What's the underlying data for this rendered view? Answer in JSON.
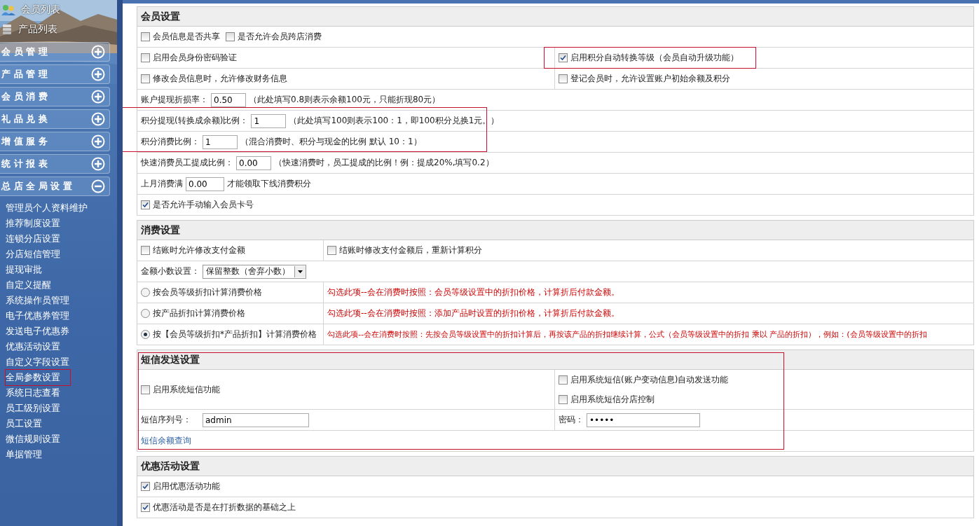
{
  "sidebar": {
    "top_links": [
      {
        "label": "会员列表"
      },
      {
        "label": "产品列表"
      }
    ],
    "groups": [
      {
        "label": "会 员 管 理",
        "expanded": false
      },
      {
        "label": "产 品 管 理",
        "expanded": false
      },
      {
        "label": "会 员 消 费",
        "expanded": false
      },
      {
        "label": "礼 品 兑 换",
        "expanded": false
      },
      {
        "label": "增 值 服 务",
        "expanded": false
      },
      {
        "label": "统 计 报 表",
        "expanded": false
      },
      {
        "label": "总 店 全 局 设 置",
        "expanded": true,
        "items": [
          {
            "label": "管理员个人资料维护",
            "highlighted": false
          },
          {
            "label": "推荐制度设置",
            "highlighted": false
          },
          {
            "label": "连锁分店设置",
            "highlighted": false
          },
          {
            "label": "分店短信管理",
            "highlighted": false
          },
          {
            "label": "提现审批",
            "highlighted": false
          },
          {
            "label": "自定义提醒",
            "highlighted": false
          },
          {
            "label": "系统操作员管理",
            "highlighted": false
          },
          {
            "label": "电子优惠券管理",
            "highlighted": false
          },
          {
            "label": "发送电子优惠券",
            "highlighted": false
          },
          {
            "label": "优惠活动设置",
            "highlighted": false
          },
          {
            "label": "自定义字段设置",
            "highlighted": false
          },
          {
            "label": "全局参数设置",
            "highlighted": true
          },
          {
            "label": "系统日志查看",
            "highlighted": false
          },
          {
            "label": "员工级别设置",
            "highlighted": false
          },
          {
            "label": "员工设置",
            "highlighted": false
          },
          {
            "label": "微信规则设置",
            "highlighted": false
          },
          {
            "label": "单据管理",
            "highlighted": false
          }
        ]
      }
    ]
  },
  "sections": [
    {
      "title": "会员设置",
      "highlighted": false,
      "rows": [
        {
          "kind": "checks",
          "cells": [
            [
              {
                "label": "会员信息是否共享",
                "checked": false,
                "highlighted": false
              },
              {
                "label": "是否允许会员跨店消费",
                "checked": false,
                "highlighted": false
              }
            ]
          ]
        },
        {
          "kind": "checks",
          "cells": [
            [
              {
                "label": "启用会员身份密码验证",
                "checked": false,
                "highlighted": false
              }
            ],
            [
              {
                "label": "启用积分自动转换等级（会员自动升级功能）",
                "checked": true,
                "highlighted": true
              }
            ]
          ]
        },
        {
          "kind": "checks",
          "cells": [
            [
              {
                "label": "修改会员信息时，允许修改财务信息",
                "checked": false,
                "highlighted": false
              }
            ],
            [
              {
                "label": "登记会员时，允许设置账户初始余额及积分",
                "checked": false,
                "highlighted": false
              }
            ]
          ]
        },
        {
          "kind": "field",
          "label": "账户提现折损率：",
          "value": "0.50",
          "note": "（此处填写0.8则表示余额100元，只能折现80元）"
        },
        {
          "kind": "group",
          "highlighted": true,
          "rows": [
            {
              "kind": "field",
              "label": "积分提现(转换成余额)比例：",
              "value": "1",
              "note": "（此处填写100则表示100：1，即100积分兑换1元。）"
            },
            {
              "kind": "field",
              "label": "积分消费比例：",
              "value": "1",
              "note": "（混合消费时、积分与现金的比例 默认 10：1）"
            }
          ]
        },
        {
          "kind": "field",
          "label": "快速消费员工提成比例：",
          "value": "0.00",
          "note": "（快速消费时，员工提成的比例！例：提成20%,填写0.2）"
        },
        {
          "kind": "field",
          "label": "上月消费满",
          "value": "0.00",
          "note": "才能领取下线消费积分"
        },
        {
          "kind": "checks",
          "cells": [
            [
              {
                "label": "是否允许手动输入会员卡号",
                "checked": true,
                "highlighted": false
              }
            ]
          ]
        }
      ]
    },
    {
      "title": "消费设置",
      "highlighted": false,
      "rows": [
        {
          "kind": "checks",
          "cells": [
            [
              {
                "label": "结账时允许修改支付金额",
                "checked": false,
                "highlighted": false
              }
            ],
            [
              {
                "label": "结账时修改支付金额后，重新计算积分",
                "checked": false,
                "highlighted": false
              }
            ]
          ]
        },
        {
          "kind": "select",
          "label": "金额小数设置：",
          "value": "保留整数（舍弃小数）"
        },
        {
          "kind": "radio",
          "label": "按会员等级折扣计算消费价格",
          "selected": false,
          "note": "勾选此项--会在消费时按照：会员等级设置中的折扣价格，计算折后付款金额。"
        },
        {
          "kind": "radio",
          "label": "按产品折扣计算消费价格",
          "selected": false,
          "note": "勾选此项--会在消费时按照：添加产品时设置的折扣价格，计算折后付款金额。"
        },
        {
          "kind": "radio",
          "label": "按【会员等级折扣*产品折扣】计算消费价格",
          "selected": true,
          "note": "勾选此项--会在消费时按照：先按会员等级设置中的折扣计算后，再按该产品的折扣继续计算，公式（会员等级设置中的折扣 乘以 产品的折扣），例如：(会员等级设置中的折扣"
        }
      ]
    },
    {
      "title": "短信发送设置",
      "highlighted": true,
      "rows": [
        {
          "kind": "checks",
          "cells": [
            [
              {
                "label": "启用系统短信功能",
                "checked": false,
                "highlighted": false
              }
            ],
            [
              {
                "label": "启用系统短信(账户变动信息)自动发送功能",
                "checked": false,
                "highlighted": false
              },
              {
                "label": "启用系统短信分店控制",
                "checked": false,
                "highlighted": false
              }
            ]
          ]
        },
        {
          "kind": "fields",
          "cells": [
            {
              "label": "短信序列号：",
              "value": "admin"
            },
            {
              "label": "密码：",
              "value": "•••••"
            }
          ]
        },
        {
          "kind": "link",
          "label": "短信余额查询"
        }
      ]
    },
    {
      "title": "优惠活动设置",
      "highlighted": false,
      "rows": [
        {
          "kind": "checks",
          "cells": [
            [
              {
                "label": "启用优惠活动功能",
                "checked": true,
                "highlighted": false
              }
            ]
          ]
        },
        {
          "kind": "checks",
          "cells": [
            [
              {
                "label": "优惠活动是否是在打折数据的基础之上",
                "checked": true,
                "highlighted": false
              }
            ]
          ]
        }
      ]
    }
  ]
}
